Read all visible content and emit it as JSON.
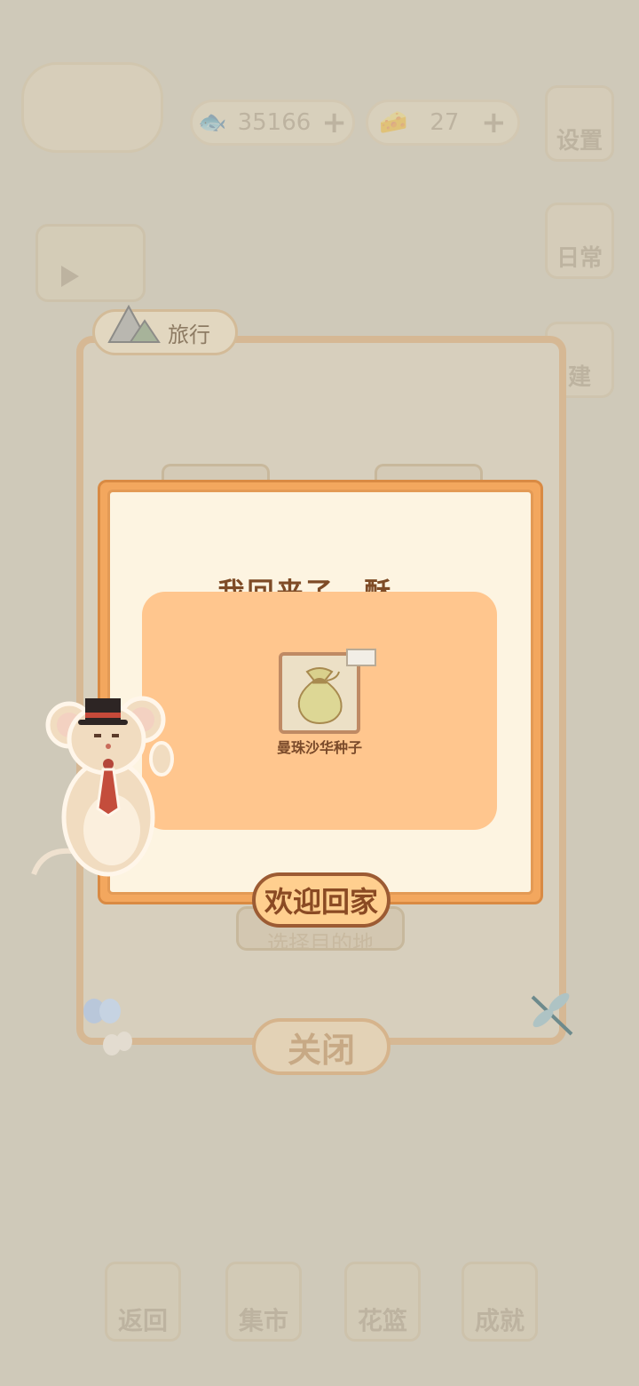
{
  "hud": {
    "fish_count": "35166",
    "cheese_count": "27",
    "settings_label": "设置"
  },
  "side_menu": {
    "daily_label": "日常",
    "build_label": "建"
  },
  "travel_panel": {
    "tab_label": "旅行",
    "select_label": "选择目的地",
    "close_label": "关闭"
  },
  "popup": {
    "title": "我回来了，酥。",
    "item_name": "曼珠沙华种子",
    "welcome_label": "欢迎回家"
  },
  "bottom_nav": {
    "back": "返回",
    "market": "集市",
    "basket": "花篮",
    "achievement": "成就"
  },
  "colors": {
    "accent": "#f3a75e",
    "reward_bg": "#ffc68e",
    "text_brown": "#7e4b26"
  }
}
